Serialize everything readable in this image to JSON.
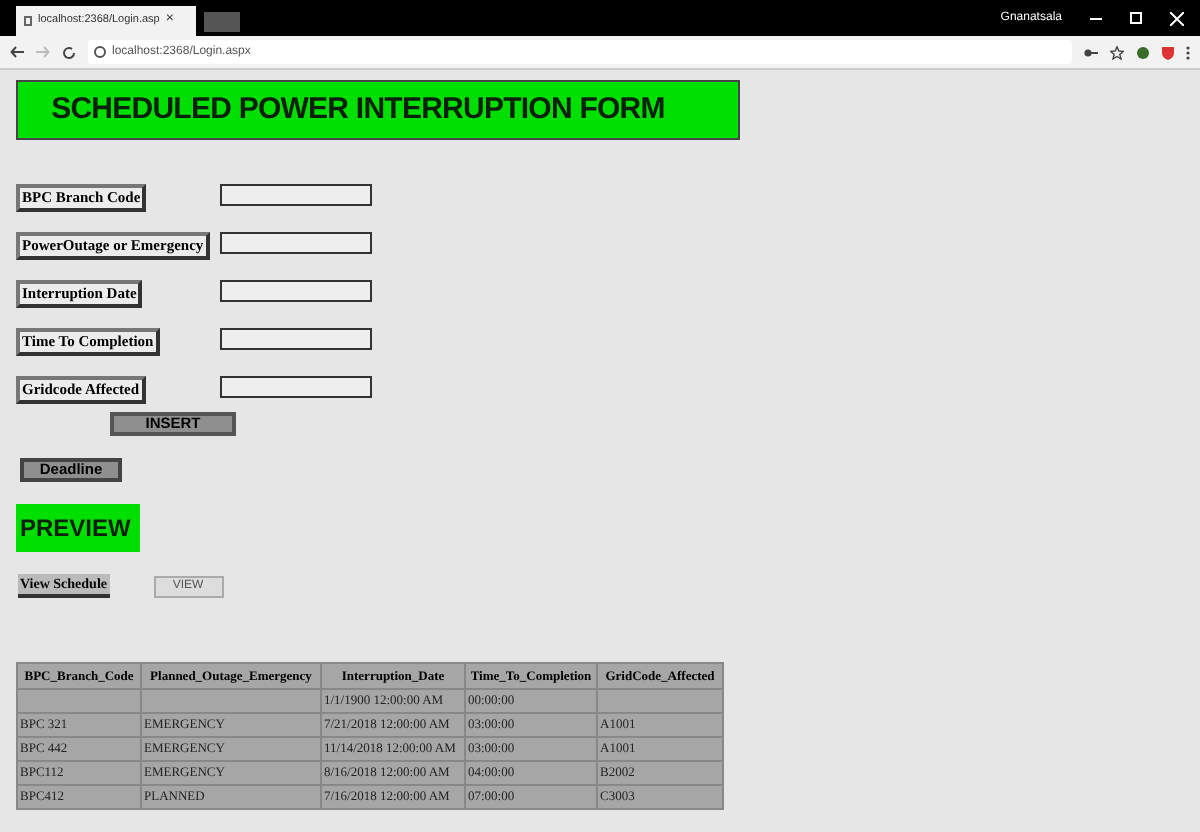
{
  "browser": {
    "tab_title": "localhost:2368/Login.asp",
    "tab_close": "×",
    "profile": "Gnanatsala",
    "address": "localhost:2368/Login.aspx"
  },
  "form": {
    "title": "SCHEDULED POWER INTERRUPTION FORM",
    "fields": [
      {
        "label": "BPC Branch Code"
      },
      {
        "label": "PowerOutage or Emergency"
      },
      {
        "label": "Interruption Date"
      },
      {
        "label": "Time To Completion"
      },
      {
        "label": "Gridcode Affected"
      }
    ],
    "insert_button": "INSERT",
    "deadline_button": "Deadline"
  },
  "preview": {
    "title": "PREVIEW",
    "view_label": "View Schedule",
    "view_button": "VIEW"
  },
  "table": {
    "columns": [
      "BPC_Branch_Code",
      "Planned_Outage_Emergency",
      "Interruption_Date",
      "Time_To_Completion",
      "GridCode_Affected"
    ],
    "rows": [
      [
        "",
        "",
        "1/1/1900 12:00:00 AM",
        "00:00:00",
        ""
      ],
      [
        "BPC 321",
        "EMERGENCY",
        "7/21/2018 12:00:00 AM",
        "03:00:00",
        "A1001"
      ],
      [
        "BPC 442",
        "EMERGENCY",
        "11/14/2018 12:00:00 AM",
        "03:00:00",
        "A1001"
      ],
      [
        "BPC112",
        "EMERGENCY",
        "8/16/2018 12:00:00 AM",
        "04:00:00",
        "B2002"
      ],
      [
        "BPC412",
        "PLANNED",
        "7/16/2018 12:00:00 AM",
        "07:00:00",
        "C3003"
      ]
    ]
  }
}
